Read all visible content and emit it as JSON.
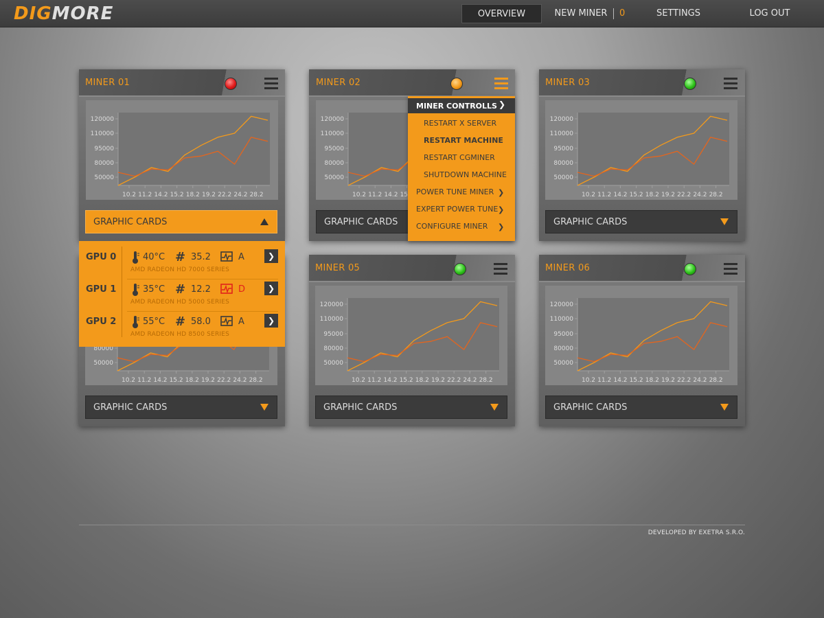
{
  "brand": {
    "part1": "DIG",
    "part2": "MORE"
  },
  "nav": {
    "overview": "OVERVIEW",
    "new_miner": "NEW MINER",
    "new_miner_count": "0",
    "settings": "SETTINGS",
    "logout": "LOG OUT"
  },
  "miners": [
    {
      "title": "MINER 01",
      "status": "red"
    },
    {
      "title": "MINER 02",
      "status": "orange"
    },
    {
      "title": "MINER 03",
      "status": "green"
    },
    {
      "title": "",
      "status": ""
    },
    {
      "title": "MINER 05",
      "status": "green"
    },
    {
      "title": "MINER 06",
      "status": "green"
    }
  ],
  "graphic_cards_label": "GRAPHIC CARDS",
  "gpus": [
    {
      "name": "GPU 0",
      "temp": "40°C",
      "hash": "35.2",
      "state": "A",
      "state_error": false,
      "model": "AMD RADEON HD 7000 SERIES"
    },
    {
      "name": "GPU 1",
      "temp": "35°C",
      "hash": "12.2",
      "state": "D",
      "state_error": true,
      "model": "AMD RADEON HD 5000 SERIES"
    },
    {
      "name": "GPU 2",
      "temp": "55°C",
      "hash": "58.0",
      "state": "A",
      "state_error": false,
      "model": "AMD RADEON HD 8500 SERIES"
    }
  ],
  "miner_menu": {
    "header": "MINER CONTROLLS",
    "items": [
      {
        "label": "RESTART X SERVER",
        "submenu": false,
        "indent": true,
        "bold": false
      },
      {
        "label": "RESTART MACHINE",
        "submenu": false,
        "indent": true,
        "bold": true
      },
      {
        "label": "RESTART CGMINER",
        "submenu": false,
        "indent": true,
        "bold": false
      },
      {
        "label": "SHUTDOWN MACHINE",
        "submenu": false,
        "indent": true,
        "bold": false
      },
      {
        "label": "POWER TUNE MINER",
        "submenu": true,
        "indent": false,
        "bold": false
      },
      {
        "label": "EXPERT POWER TUNE",
        "submenu": true,
        "indent": false,
        "bold": false
      },
      {
        "label": "CONFIGURE MINER",
        "submenu": true,
        "indent": false,
        "bold": false
      }
    ]
  },
  "chart_data": {
    "type": "line",
    "x": [
      "10.2",
      "11.2",
      "14.2",
      "15.2",
      "18.2",
      "19.2",
      "22.2",
      "24.2",
      "28.2"
    ],
    "y_ticks": [
      "120000",
      "110000",
      "95000",
      "80000",
      "50000"
    ],
    "series": [
      {
        "color": "#f39a1b",
        "values": [
          20000,
          50000,
          70000,
          62000,
          88000,
          98000,
          106000,
          110000,
          124000,
          119000
        ]
      },
      {
        "color": "#e5651d",
        "values": [
          60000,
          52000,
          67000,
          65000,
          85000,
          87000,
          92000,
          77000,
          106000,
          102000
        ]
      }
    ]
  },
  "footer": "DEVELOPED BY EXETRA S.R.O.",
  "colors": {
    "accent": "#f39a1b",
    "dark": "#3b3b3b",
    "error": "#e2231a"
  }
}
